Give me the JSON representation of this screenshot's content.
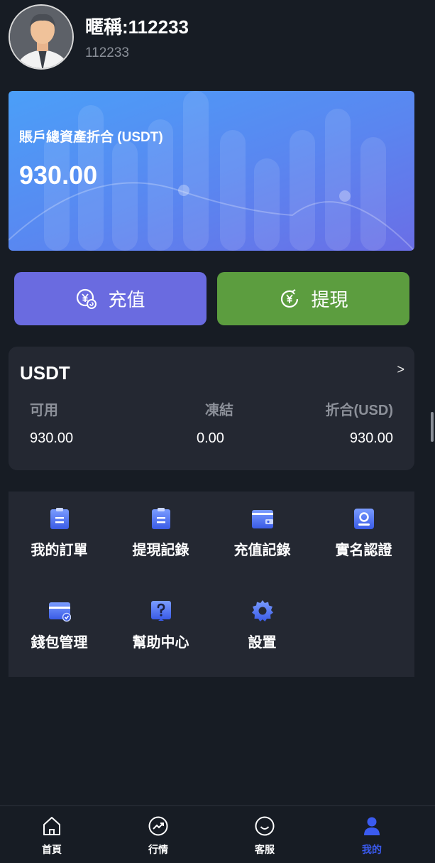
{
  "profile": {
    "nickname": "暱稱:112233",
    "uid": "112233",
    "avatar_icon": "user-avatar-icon"
  },
  "balance": {
    "label": "賬戶總資產折合 (USDT)",
    "value": "930.00"
  },
  "actions": {
    "deposit_label": "充值",
    "withdraw_label": "提現",
    "deposit_color": "#6a6be0",
    "withdraw_color": "#5c9d3f"
  },
  "usdt": {
    "title": "USDT",
    "arrow": ">",
    "headers": [
      "可用",
      "凍結",
      "折合(USD)"
    ],
    "values": [
      "930.00",
      "0.00",
      "930.00"
    ]
  },
  "menu": {
    "items": [
      {
        "label": "我的訂單",
        "icon": "clipboard-icon"
      },
      {
        "label": "提現記錄",
        "icon": "clipboard-icon"
      },
      {
        "label": "充值記錄",
        "icon": "wallet-icon"
      },
      {
        "label": "實名認證",
        "icon": "id-card-icon"
      },
      {
        "label": "錢包管理",
        "icon": "card-icon"
      },
      {
        "label": "幫助中心",
        "icon": "question-icon"
      },
      {
        "label": "設置",
        "icon": "gear-icon"
      }
    ]
  },
  "tabbar": {
    "items": [
      {
        "label": "首頁",
        "icon": "home-icon"
      },
      {
        "label": "行情",
        "icon": "chart-icon"
      },
      {
        "label": "客服",
        "icon": "smile-icon"
      },
      {
        "label": "我的",
        "icon": "user-icon"
      }
    ],
    "active_color": "#3b5bf0"
  }
}
